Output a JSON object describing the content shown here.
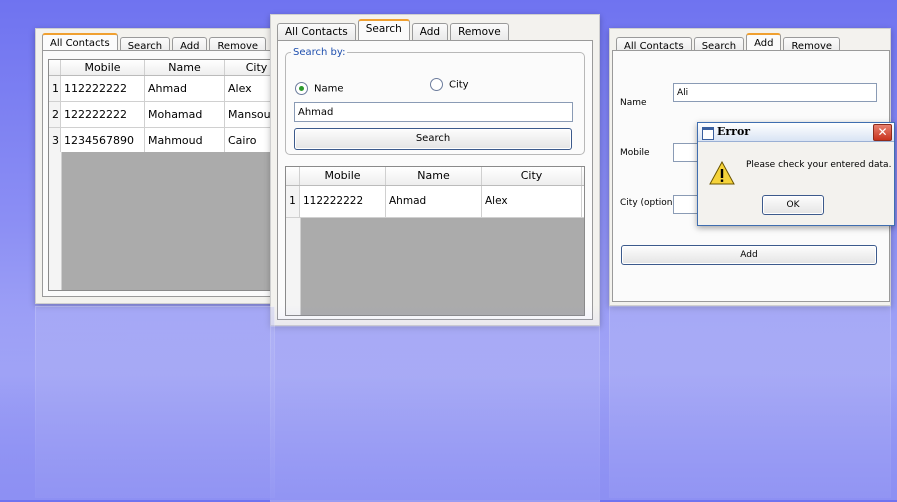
{
  "tabs": [
    "All Contacts",
    "Search",
    "Add",
    "Remove"
  ],
  "left_panel": {
    "active_tab": "All Contacts",
    "columns": [
      "Mobile",
      "Name",
      "City"
    ],
    "rows": [
      {
        "n": "1",
        "mobile": "112222222",
        "name": "Ahmad",
        "city": "Alex"
      },
      {
        "n": "2",
        "mobile": "122222222",
        "name": "Mohamad",
        "city": "Mansoura"
      },
      {
        "n": "3",
        "mobile": "1234567890",
        "name": "Mahmoud",
        "city": "Cairo"
      }
    ]
  },
  "middle_panel": {
    "active_tab": "Search",
    "search_by_label": "Search by:",
    "option_name": "Name",
    "option_city": "City",
    "search_value": "Ahmad",
    "search_button": "Search",
    "columns": [
      "Mobile",
      "Name",
      "City"
    ],
    "rows": [
      {
        "n": "1",
        "mobile": "112222222",
        "name": "Ahmad",
        "city": "Alex"
      }
    ]
  },
  "right_panel": {
    "active_tab": "Add",
    "name_label": "Name",
    "name_value": "Ali",
    "mobile_label": "Mobile",
    "city_label": "City (optional)",
    "add_button": "Add"
  },
  "error_dialog": {
    "title": "Error",
    "message": "Please check your entered data.",
    "ok_button": "OK"
  },
  "colors": {
    "background": "#8c8ff4",
    "active_tab_accent": "#f0a030",
    "legend_blue": "#1f4fae",
    "close_red": "#d9452f"
  }
}
